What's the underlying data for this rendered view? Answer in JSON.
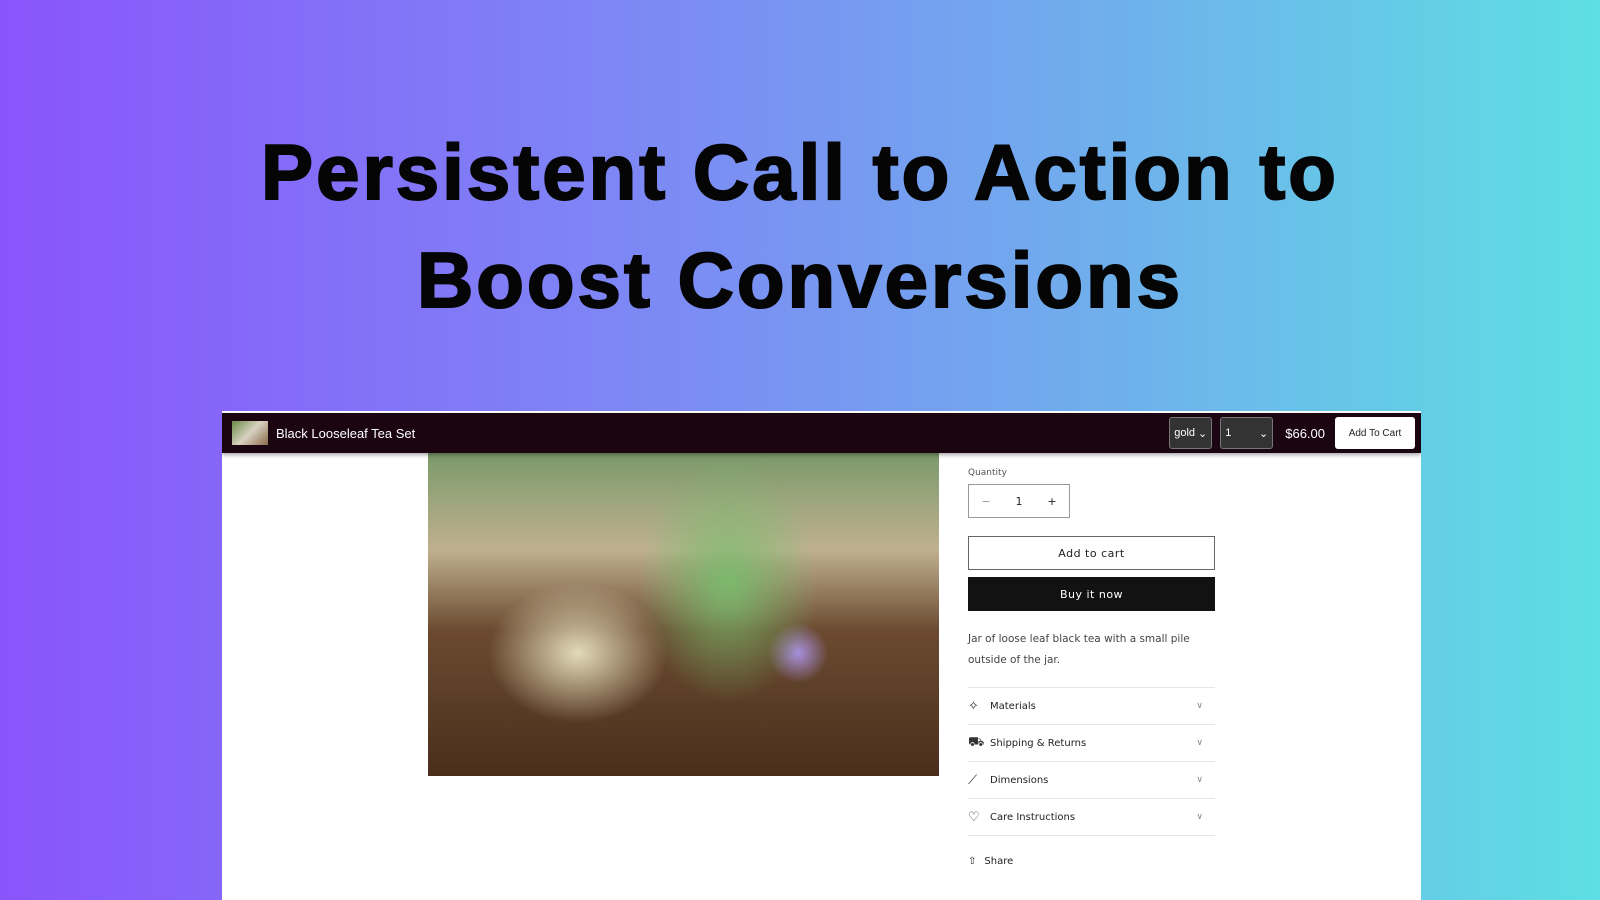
{
  "headline": {
    "line1": "Persistent Call to Action to",
    "line2": "Boost Conversions"
  },
  "sticky_bar": {
    "product_title": "Black Looseleaf Tea Set",
    "variant": "gold",
    "quantity": "1",
    "price": "$66.00",
    "add_to_cart": "Add To Cart"
  },
  "product": {
    "quantity_label": "Quantity",
    "quantity_value": "1",
    "minus": "−",
    "plus": "+",
    "add_to_cart": "Add to cart",
    "buy_now": "Buy it now",
    "description": "Jar of loose leaf black tea with a small pile outside of the jar.",
    "accordion": [
      {
        "label": "Materials",
        "icon": "leather-icon",
        "glyph": "✧"
      },
      {
        "label": "Shipping & Returns",
        "icon": "truck-icon",
        "glyph": "⛟"
      },
      {
        "label": "Dimensions",
        "icon": "ruler-icon",
        "glyph": "📏"
      },
      {
        "label": "Care Instructions",
        "icon": "heart-icon",
        "glyph": "♡"
      }
    ],
    "share": "Share"
  }
}
